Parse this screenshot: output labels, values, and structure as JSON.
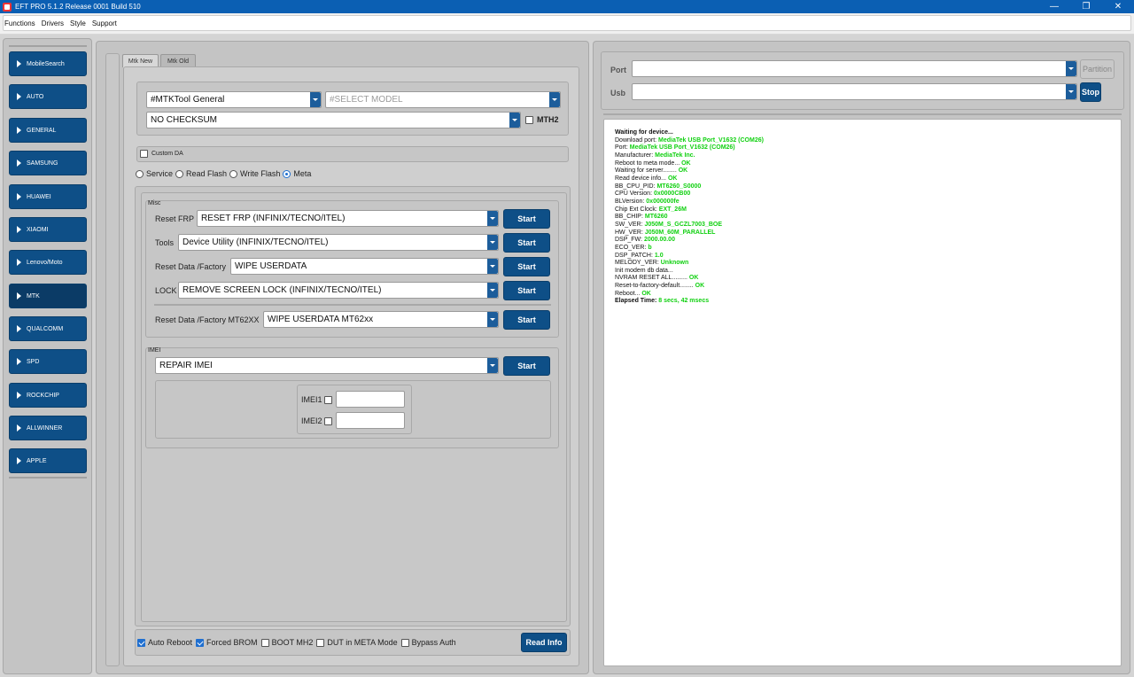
{
  "window": {
    "title": "EFT PRO 5.1.2 Release 0001 Build 510"
  },
  "menu": [
    "Functions",
    "Drivers",
    "Style",
    "Support"
  ],
  "sidebar": {
    "items": [
      {
        "label": "MobileSearch"
      },
      {
        "label": "AUTO"
      },
      {
        "label": "GENERAL"
      },
      {
        "label": "SAMSUNG"
      },
      {
        "label": "HUAWEI"
      },
      {
        "label": "XIAOMI"
      },
      {
        "label": "Lenovo/Moto"
      },
      {
        "label": "MTK"
      },
      {
        "label": "QUALCOMM"
      },
      {
        "label": "SPD"
      },
      {
        "label": "ROCKCHIP"
      },
      {
        "label": "ALLWINNER"
      },
      {
        "label": "APPLE"
      }
    ],
    "active": "MTK"
  },
  "tabs": [
    {
      "label": "Mtk New"
    },
    {
      "label": "Mtk Old"
    }
  ],
  "mtk": {
    "tool_combo": "#MTKTool General",
    "model_combo": "#SELECT MODEL",
    "checksum_combo": "NO CHECKSUM",
    "mth2_label": "MTH2",
    "custom_da_label": "Custom DA",
    "modes": [
      {
        "label": "Service",
        "selected": false
      },
      {
        "label": "Read Flash",
        "selected": false
      },
      {
        "label": "Write Flash",
        "selected": false
      },
      {
        "label": "Meta",
        "selected": true
      }
    ],
    "misc": {
      "title": "Misc",
      "rows": [
        {
          "label": "Reset FRP",
          "value": "RESET FRP (INFINIX/TECNO/ITEL)",
          "button": "Start"
        },
        {
          "label": "Tools",
          "value": "Device Utility (INFINIX/TECNO/ITEL)",
          "button": "Start"
        },
        {
          "label": "Reset Data /Factory",
          "value": "WIPE USERDATA",
          "button": "Start"
        },
        {
          "label": "LOCK",
          "value": "REMOVE SCREEN LOCK (INFINIX/TECNO/ITEL)",
          "button": "Start"
        },
        {
          "label": "Reset Data /Factory MT62XX",
          "value": "WIPE USERDATA  MT62xx",
          "button": "Start"
        }
      ]
    },
    "imei": {
      "title": "IMEI",
      "combo": "REPAIR IMEI",
      "button": "Start",
      "imei1_label": "IMEI1",
      "imei2_label": "IMEI2",
      "imei1_value": "",
      "imei2_value": ""
    },
    "options": [
      {
        "label": "Auto Reboot",
        "checked": true
      },
      {
        "label": "Forced BROM",
        "checked": true
      },
      {
        "label": "BOOT MH2",
        "checked": false
      },
      {
        "label": "DUT in META Mode",
        "checked": false
      },
      {
        "label": "Bypass Auth",
        "checked": false
      }
    ],
    "read_info_button": "Read Info"
  },
  "connection": {
    "port_label": "Port",
    "usb_label": "Usb",
    "port_value": "",
    "usb_value": "",
    "partition_button": "Partition",
    "stop_button": "Stop"
  },
  "log": [
    {
      "text": " Waiting for device...",
      "bold": true,
      "value": ""
    },
    {
      "text": "Download port: ",
      "value": "MediaTek USB Port_V1632 (COM26)"
    },
    {
      "text": "Port: ",
      "value": "MediaTek USB Port_V1632 (COM26)"
    },
    {
      "text": "Manufacturer: ",
      "value": "MediaTek Inc."
    },
    {
      "text": "Reboot to meta mode... ",
      "value": "OK"
    },
    {
      "text": "Waiting for server........ ",
      "value": "OK"
    },
    {
      "text": "Read device info... ",
      "value": "OK"
    },
    {
      "text": " BB_CPU_PID: ",
      "value": "MT6260_S0000"
    },
    {
      "text": " CPU Version: ",
      "value": "0x0000CB00"
    },
    {
      "text": " BLVersion: ",
      "value": "0x000000fe"
    },
    {
      "text": " Chip Ext Clock: ",
      "value": "EXT_26M"
    },
    {
      "text": " BB_CHIP: ",
      "value": "MT6260"
    },
    {
      "text": " SW_VER: ",
      "value": "J050M_S_GCZL7003_BOE"
    },
    {
      "text": " HW_VER: ",
      "value": "J050M_60M_PARALLEL"
    },
    {
      "text": " DSP_FW: ",
      "value": "2000.00.00"
    },
    {
      "text": " ECO_VER: ",
      "value": "b"
    },
    {
      "text": " DSP_PATCH: ",
      "value": "1.0"
    },
    {
      "text": " MELODY_VER: ",
      "value": "Unknown"
    },
    {
      "text": "Init modem db data...",
      "value": ""
    },
    {
      "text": "NVRAM RESET ALL......... ",
      "value": "OK"
    },
    {
      "text": "Reset-to-factory-default........ ",
      "value": "OK"
    },
    {
      "text": "Reboot... ",
      "value": "OK"
    },
    {
      "text": "Elapsed Time: ",
      "bold": true,
      "value": "8 secs, 42 msecs"
    }
  ]
}
